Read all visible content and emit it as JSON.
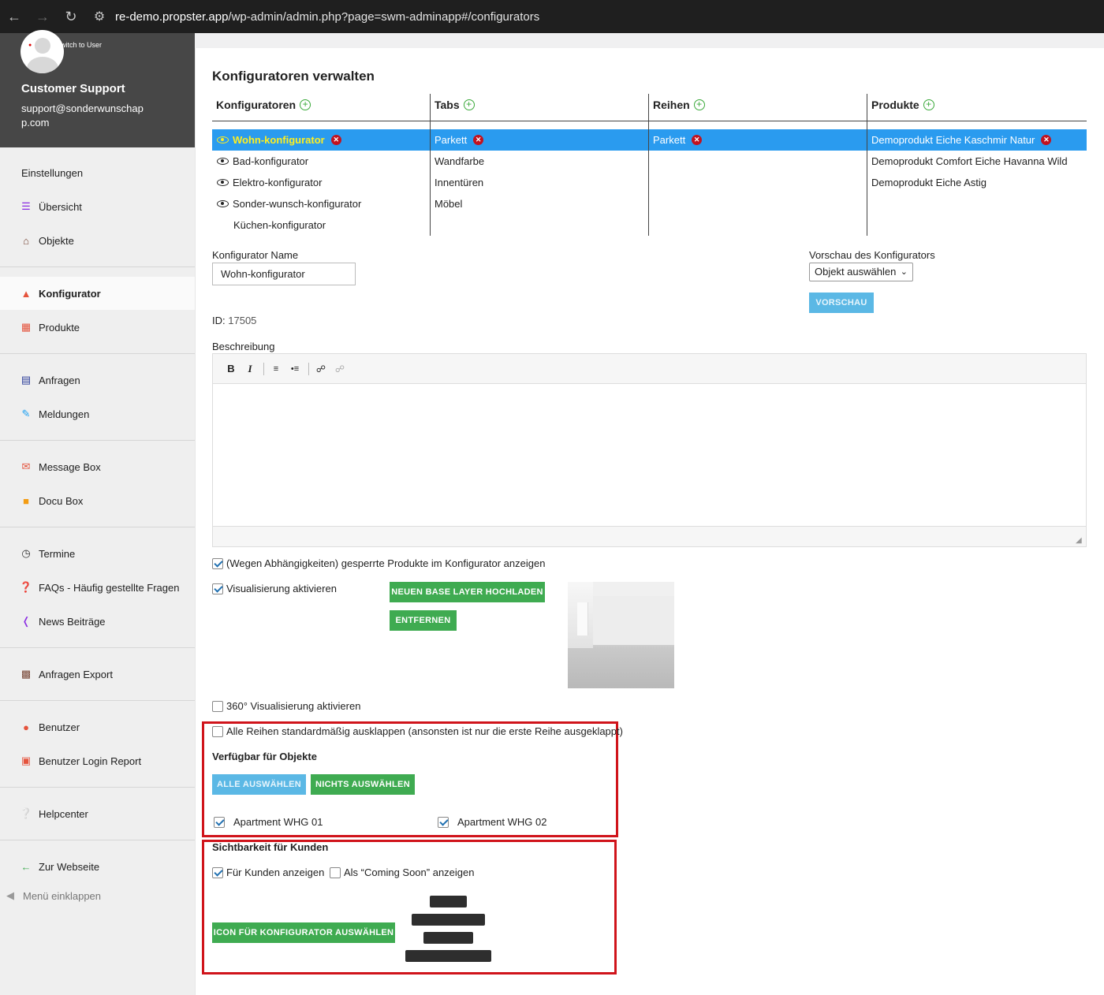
{
  "browser": {
    "url_host": "re-demo.propster.app",
    "url_path": "/wp-admin/admin.php?page=swm-adminapp#/configurators"
  },
  "profile": {
    "switch_label": "Switch to User",
    "name": "Customer Support",
    "email": "support@sonderwunschapp.com"
  },
  "sidebar": {
    "settings": "Einstellungen",
    "items": [
      {
        "label": "Übersicht",
        "icon": "menu-lines-icon",
        "color": "#8a2be2"
      },
      {
        "label": "Objekte",
        "icon": "house-icon",
        "color": "#7a4a3a"
      },
      {
        "label": "Konfigurator",
        "icon": "sitemap-icon",
        "color": "#e5533c"
      },
      {
        "label": "Produkte",
        "icon": "grid-box-icon",
        "color": "#e5533c"
      },
      {
        "label": "Anfragen",
        "icon": "list-table-icon",
        "color": "#2c3e9a"
      },
      {
        "label": "Meldungen",
        "icon": "edit-note-icon",
        "color": "#1da1f2"
      },
      {
        "label": "Message Box",
        "icon": "message-icon",
        "color": "#e5533c"
      },
      {
        "label": "Docu Box",
        "icon": "folder-icon",
        "color": "#f39c12"
      },
      {
        "label": "Termine",
        "icon": "clock-icon",
        "color": "#333333"
      },
      {
        "label": "FAQs - Häufig gestellte Fragen",
        "icon": "question-icon",
        "color": "#333333"
      },
      {
        "label": "News Beiträge",
        "icon": "rss-icon",
        "color": "#8a2be2"
      },
      {
        "label": "Anfragen Export",
        "icon": "calculator-icon",
        "color": "#7a4a3a"
      },
      {
        "label": "Benutzer",
        "icon": "user-icon",
        "color": "#e5533c"
      },
      {
        "label": "Benutzer Login Report",
        "icon": "id-card-icon",
        "color": "#e5533c"
      },
      {
        "label": "Helpcenter",
        "icon": "help-circle-icon",
        "color": "#1e3a8a"
      },
      {
        "label": "Zur Webseite",
        "icon": "arrow-left-icon",
        "color": "#3fab51"
      }
    ],
    "collapse": "Menü einklappen"
  },
  "main": {
    "title": "Konfiguratoren verwalten",
    "columns": {
      "configurators": "Konfiguratoren",
      "tabs": "Tabs",
      "rows": "Reihen",
      "products": "Produkte"
    },
    "configurators": [
      "Wohn-konfigurator",
      "Bad-konfigurator",
      "Elektro-konfigurator",
      "Sonder-wunsch-konfigurator",
      "Küchen-konfigurator"
    ],
    "tabs": [
      "Parkett",
      "Wandfarbe",
      "Innentüren",
      "Möbel"
    ],
    "rows": [
      "Parkett"
    ],
    "products": [
      "Demoprodukt Eiche Kaschmir Natur",
      "Demoprodukt Comfort Eiche Havanna Wild",
      "Demoprodukt Eiche Astig"
    ],
    "name_label": "Konfigurator Name",
    "name_value": "Wohn-konfigurator",
    "preview_label": "Vorschau des Konfigurators",
    "preview_select": "Objekt auswählen",
    "preview_button": "VORSCHAU",
    "id_label": "ID:",
    "id_value": "17505",
    "description_label": "Beschreibung",
    "check_locked": "(Wegen Abhängigkeiten) gesperrte Produkte im Konfigurator anzeigen",
    "check_visual": "Visualisierung aktivieren",
    "upload_button": "NEUEN BASE LAYER HOCHLADEN",
    "remove_button": "ENTFERNEN",
    "check_360": "360° Visualisierung aktivieren",
    "check_expand": "Alle Reihen standardmäßig ausklappen (ansonsten ist nur die erste Reihe ausgeklappt)",
    "available_title": "Verfügbar für Objekte",
    "select_all": "ALLE AUSWÄHLEN",
    "select_none": "NICHTS AUSWÄHLEN",
    "objects": [
      "Apartment WHG 01",
      "Apartment WHG 02"
    ],
    "visibility_title": "Sichtbarkeit für Kunden",
    "check_customers": "Für Kunden anzeigen",
    "check_coming_soon": "Als “Coming Soon” anzeigen",
    "icon_button": "ICON FÜR KONFIGURATOR AUSWÄHLEN"
  },
  "colors": {
    "selection": "#2a9bef",
    "highlight_text": "#ffef1f",
    "green": "#3fab51",
    "blue_button": "#5bb8e5",
    "annotation_red": "#d0141b"
  }
}
